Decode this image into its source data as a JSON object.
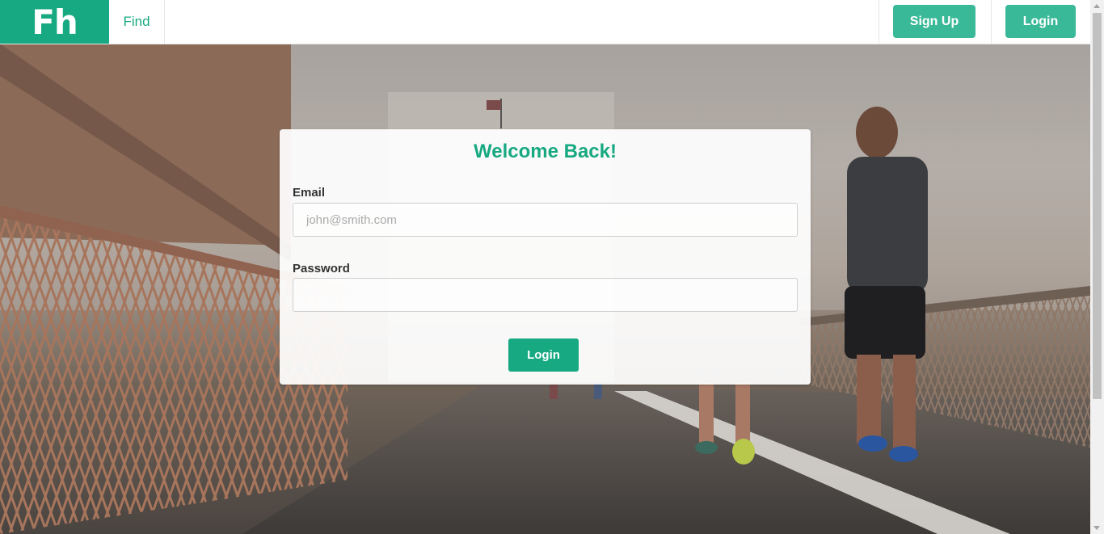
{
  "brand": {
    "logo_text": "Fh",
    "color": "#17a981"
  },
  "nav": {
    "find_label": "Find",
    "signup_label": "Sign Up",
    "login_label": "Login"
  },
  "login_form": {
    "title": "Welcome Back!",
    "email_label": "Email",
    "email_placeholder": "john@smith.com",
    "email_value": "",
    "password_label": "Password",
    "password_value": "",
    "submit_label": "Login"
  },
  "colors": {
    "accent": "#17a981",
    "nav_button": "#3ab998"
  }
}
